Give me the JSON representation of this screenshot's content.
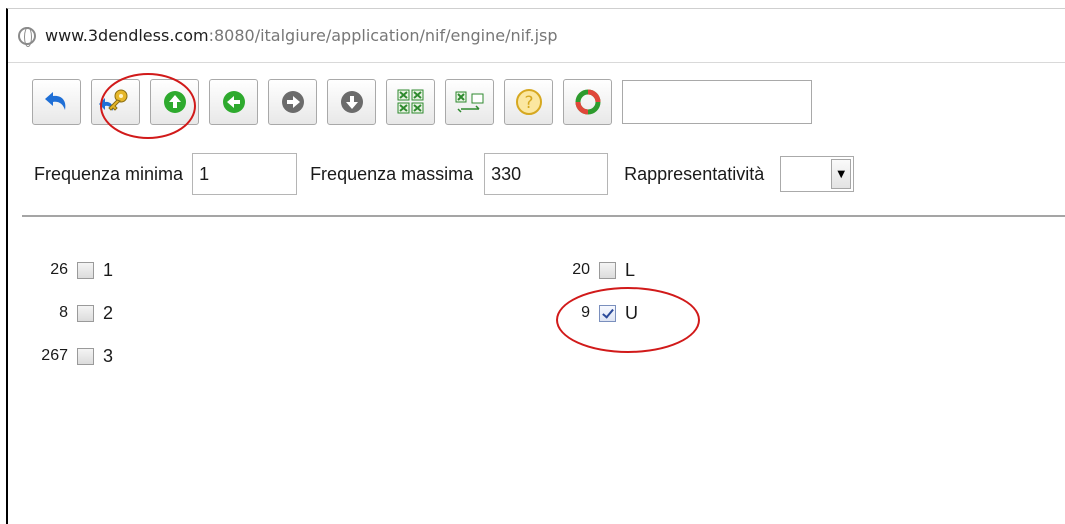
{
  "browser": {
    "url_host": "www.3dendless.com",
    "url_path": ":8080/italgiure/application/nif/engine/nif.jsp"
  },
  "toolbar": {
    "buttons": [
      {
        "name": "undo-icon"
      },
      {
        "name": "key-return-icon"
      },
      {
        "name": "arrow-up-icon"
      },
      {
        "name": "arrow-left-icon"
      },
      {
        "name": "arrow-right-icon"
      },
      {
        "name": "arrow-down-icon"
      },
      {
        "name": "expand-grid-icon"
      },
      {
        "name": "swap-panels-icon"
      },
      {
        "name": "help-icon"
      },
      {
        "name": "refresh-icon"
      }
    ],
    "search_value": ""
  },
  "filters": {
    "min_label": "Frequenza minima",
    "min_value": "1",
    "max_label": "Frequenza massima",
    "max_value": "330",
    "rep_label": "Rappresentatività",
    "rep_value": ""
  },
  "facets": {
    "left": [
      {
        "count": "26",
        "label": "1",
        "checked": false
      },
      {
        "count": "8",
        "label": "2",
        "checked": false
      },
      {
        "count": "267",
        "label": "3",
        "checked": false
      }
    ],
    "right": [
      {
        "count": "20",
        "label": "L",
        "checked": false
      },
      {
        "count": "9",
        "label": "U",
        "checked": true
      }
    ]
  },
  "colors": {
    "annotation": "#d11a1a",
    "check": "#2b4a9a"
  }
}
